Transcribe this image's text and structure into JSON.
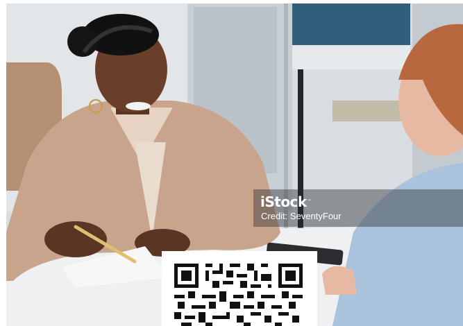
{
  "photo": {
    "description_icon": "stock-photo"
  },
  "watermark": {
    "brand": "iStock",
    "trademark": "™",
    "credit": "Credit: SeventyFour"
  },
  "qr": {
    "icon": "qr-code-icon"
  },
  "colors": {
    "watermark_bg": "#282c30",
    "qr_dark": "#111111"
  }
}
